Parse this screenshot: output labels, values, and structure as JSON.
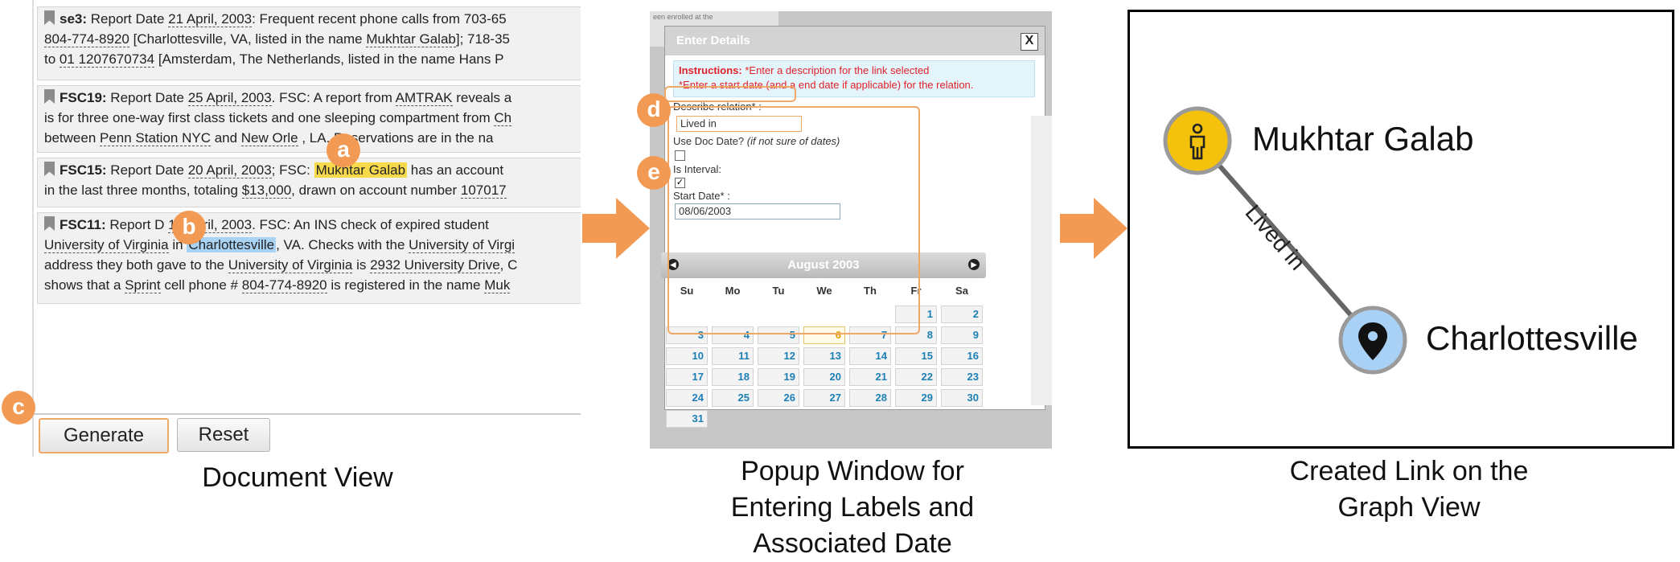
{
  "document_view": {
    "documents": [
      {
        "lines": [
          [
            {
              "t": "se3:",
              "b": 1
            },
            {
              "t": " Report Date "
            },
            {
              "t": "21 April, 2003",
              "u": 1
            },
            {
              "t": ": Frequent recent phone calls from 703-65"
            }
          ],
          [
            {
              "t": "804-774-8920",
              "u": 1
            },
            {
              "t": " [Charlottesville, VA, listed in the name "
            },
            {
              "t": "Mukhtar Galab",
              "u": 1
            },
            {
              "t": "]; 718-35"
            }
          ],
          [
            {
              "t": "to "
            },
            {
              "t": "01 1207670734",
              "u": 1
            },
            {
              "t": " [Amsterdam, The Netherlands, listed in the name Hans P"
            }
          ]
        ]
      },
      {
        "lines": [
          [
            {
              "t": "FSC19:",
              "b": 1
            },
            {
              "t": " Report Date "
            },
            {
              "t": "25 April, 2003",
              "u": 1
            },
            {
              "t": ". FSC: A report from "
            },
            {
              "t": "AMTRAK",
              "u": 1
            },
            {
              "t": " reveals a"
            }
          ],
          [
            {
              "t": "is for three one-way first class tickets and one sleeping compartment from "
            },
            {
              "t": "Ch",
              "u": 1
            }
          ],
          [
            {
              "t": "between "
            },
            {
              "t": "Penn Station NYC",
              "u": 1
            },
            {
              "t": " and "
            },
            {
              "t": "New Orle",
              "u": 1
            },
            {
              "t": "         , LA. Reservations are in the na"
            }
          ]
        ]
      },
      {
        "lines": [
          [
            {
              "t": "FSC15:",
              "b": 1
            },
            {
              "t": " Report Date "
            },
            {
              "t": "20 April, 2003",
              "u": 1
            },
            {
              "t": "; FSC: "
            },
            {
              "t": "Mukhtar Galab",
              "hl": "y"
            },
            {
              "t": " has an account"
            }
          ],
          [
            {
              "t": "in the last three months, totaling "
            },
            {
              "t": "$13,000",
              "u": 1
            },
            {
              "t": ", drawn on account number "
            },
            {
              "t": "107017",
              "u": 1
            }
          ]
        ]
      },
      {
        "lines": [
          [
            {
              "t": "FSC11:",
              "b": 1
            },
            {
              "t": " Report D      "
            },
            {
              "t": "18 April, 2003",
              "u": 1
            },
            {
              "t": ". FSC: An INS check of expired student"
            }
          ],
          [
            {
              "t": "University of Virginia",
              "u": 1
            },
            {
              "t": " in "
            },
            {
              "t": "Charlottesville",
              "hl": "b"
            },
            {
              "t": ", VA. Checks with the "
            },
            {
              "t": "University of Virgi",
              "u": 1
            }
          ],
          [
            {
              "t": "address they both gave to the "
            },
            {
              "t": "University of Virginia",
              "u": 1
            },
            {
              "t": " is "
            },
            {
              "t": "2932 University Drive",
              "u": 1
            },
            {
              "t": ", C"
            }
          ],
          [
            {
              "t": "shows that a "
            },
            {
              "t": "Sprint",
              "u": 1
            },
            {
              "t": " cell phone # "
            },
            {
              "t": "804-774-8920",
              "u": 1
            },
            {
              "t": " is registered in the name "
            },
            {
              "t": "Muk",
              "u": 1
            }
          ]
        ]
      }
    ],
    "generate_label": "Generate",
    "reset_label": "Reset"
  },
  "markers": {
    "a": "a",
    "b": "b",
    "c": "c",
    "d": "d",
    "e": "e"
  },
  "popup": {
    "title": "Enter Details",
    "close": "X",
    "instructions_label": "Instructions:",
    "instructions_1": " *Enter a description for the link selected",
    "instructions_2": "*Enter a start date (and a end date if applicable) for the relation.",
    "describe_label": "Describe relation* :",
    "describe_value": "Lived in",
    "use_doc_date_label": "Use Doc Date?",
    "use_doc_date_note": "(if not sure of dates)",
    "is_interval_label": "Is Interval:",
    "start_date_label": "Start Date* :",
    "start_date_value": "08/06/2003",
    "calendar": {
      "month": "August 2003",
      "weekdays": [
        "Su",
        "Mo",
        "Tu",
        "We",
        "Th",
        "Fr",
        "Sa"
      ],
      "days": [
        [
          "",
          "",
          "",
          "",
          "",
          "1",
          "2"
        ],
        [
          "3",
          "4",
          "5",
          "6",
          "7",
          "8",
          "9"
        ],
        [
          "10",
          "11",
          "12",
          "13",
          "14",
          "15",
          "16"
        ],
        [
          "17",
          "18",
          "19",
          "20",
          "21",
          "22",
          "23"
        ],
        [
          "24",
          "25",
          "26",
          "27",
          "28",
          "29",
          "30"
        ],
        [
          "31",
          "",
          "",
          "",
          "",
          "",
          ""
        ]
      ],
      "selected": "6"
    },
    "bg_snippet": "een enrolled at the"
  },
  "graph": {
    "node_person": "Mukhtar Galab",
    "node_place": "Charlottesville",
    "edge_label": "Lived in",
    "person_color": "#f4c20d",
    "place_color": "#a9d0f5"
  },
  "captions": {
    "document": "Document View",
    "popup_line1": "Popup Window for",
    "popup_line2": "Entering Labels and",
    "popup_line3": "Associated Date",
    "graph_line1": "Created Link on the",
    "graph_line2": "Graph View"
  },
  "accent_color": "#f29a53"
}
